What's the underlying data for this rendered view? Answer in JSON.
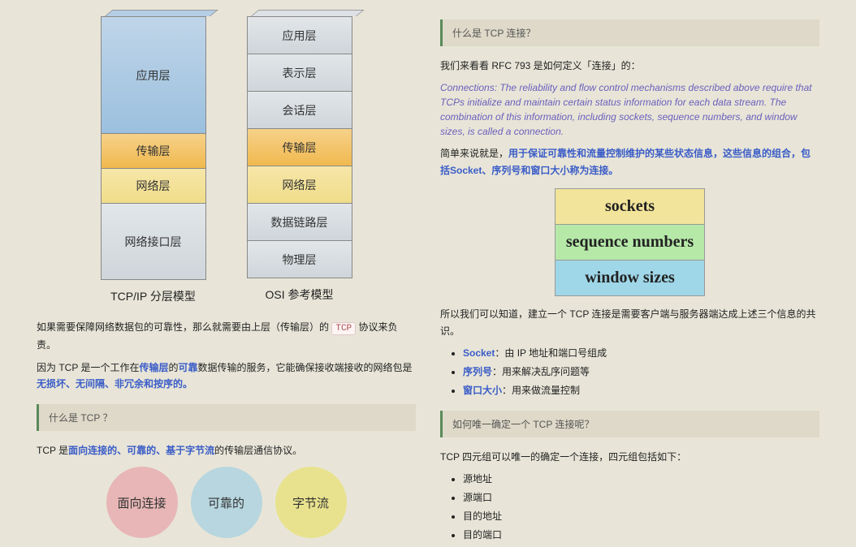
{
  "left": {
    "stacks": {
      "tcpip": {
        "label": "TCP/IP 分层模型",
        "layers": [
          "应用层",
          "传输层",
          "网络层",
          "网络接口层"
        ]
      },
      "osi": {
        "label": "OSI 参考模型",
        "layers": [
          "应用层",
          "表示层",
          "会话层",
          "传输层",
          "网络层",
          "数据链路层",
          "物理层"
        ]
      }
    },
    "p1_a": "如果需要保障网络数据包的可靠性，那么就需要由上层（传输层）的 ",
    "p1_code": "TCP",
    "p1_b": " 协议来负责。",
    "p2_a": "因为 TCP 是一个工作在",
    "p2_s1": "传输层",
    "p2_b": "的",
    "p2_s2": "可靠",
    "p2_c": "数据传输的服务，它能确保接收端接收的网络包是",
    "p2_s3": "无损坏、无间隔、非冗余和按序的。",
    "q1": "什么是 TCP ？",
    "p3_a": "TCP 是",
    "p3_s": "面向连接的、可靠的、基于字节流",
    "p3_b": "的传输层通信协议。",
    "circles": [
      "面向连接",
      "可靠的",
      "字节流"
    ]
  },
  "right": {
    "q1": "什么是 TCP 连接？",
    "p1": "我们来看看 RFC 793 是如何定义「连接」的：",
    "quote": "Connections: The reliability and flow control mechanisms described above require that TCPs initialize and maintain certain status information for each data stream. The combination of this information, including sockets, sequence numbers, and window sizes, is called a connection.",
    "p2_a": "简单来说就是，",
    "p2_s": "用于保证可靠性和流量控制维护的某些状态信息，这些信息的组合，包括Socket、序列号和窗口大小称为连接。",
    "fig": [
      "sockets",
      "sequence numbers",
      "window sizes"
    ],
    "p3": "所以我们可以知道，建立一个 TCP 连接是需要客户端与服务器端达成上述三个信息的共识。",
    "bullets1": [
      {
        "b": "Socket",
        "t": "：由 IP 地址和端口号组成"
      },
      {
        "b": "序列号",
        "t": "：用来解决乱序问题等"
      },
      {
        "b": "窗口大小",
        "t": "：用来做流量控制"
      }
    ],
    "q2": "如何唯一确定一个 TCP 连接呢？",
    "p4": "TCP 四元组可以唯一的确定一个连接，四元组包括如下：",
    "bullets2": [
      "源地址",
      "源端口",
      "目的地址",
      "目的端口"
    ]
  }
}
